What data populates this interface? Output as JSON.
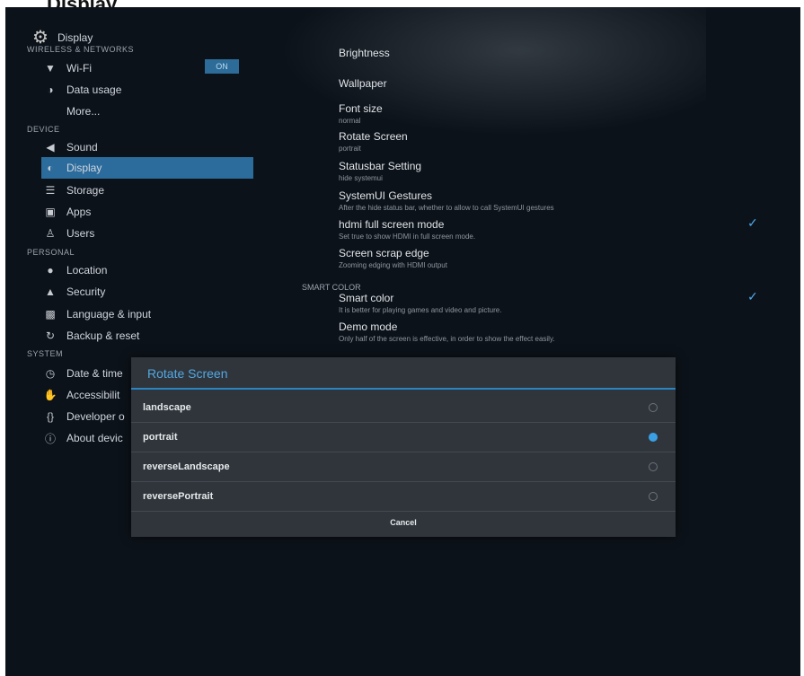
{
  "caption": "Display",
  "header": {
    "title": "Display"
  },
  "sections": {
    "wireless": "WIRELESS & NETWORKS",
    "device": "DEVICE",
    "personal": "PERSONAL",
    "system": "SYSTEM",
    "smart_color": "SMART COLOR"
  },
  "sidebar": {
    "wifi": {
      "label": "Wi-Fi",
      "toggle": "ON"
    },
    "data_usage": "Data usage",
    "more": "More...",
    "sound": "Sound",
    "display": "Display",
    "storage": "Storage",
    "apps": "Apps",
    "users": "Users",
    "location": "Location",
    "security": "Security",
    "language": "Language & input",
    "backup": "Backup & reset",
    "date_time": "Date & time",
    "accessibility": "Accessibilit",
    "developer": "Developer o",
    "about": "About devic"
  },
  "prefs": {
    "brightness": "Brightness",
    "wallpaper": "Wallpaper",
    "font_size": {
      "title": "Font size",
      "summary": "normal"
    },
    "rotate": {
      "title": "Rotate Screen",
      "summary": "portrait"
    },
    "statusbar": {
      "title": "Statusbar Setting",
      "summary": "hide systemui"
    },
    "gestures": {
      "title": "SystemUI Gestures",
      "summary": "After the hide status bar, whether to allow to call SystemUI gestures"
    },
    "hdmi": {
      "title": "hdmi full screen mode",
      "summary": "Set true to show HDMI in full screen mode."
    },
    "scrap": {
      "title": "Screen scrap edge",
      "summary": "Zooming edging with HDMI output"
    },
    "smart": {
      "title": "Smart color",
      "summary": "It is better for playing games and video and picture."
    },
    "demo": {
      "title": "Demo mode",
      "summary": "Only half of the screen is effective, in order to show the effect easily."
    }
  },
  "dialog": {
    "title": "Rotate Screen",
    "options": [
      "landscape",
      "portrait",
      "reverseLandscape",
      "reversePortrait"
    ],
    "selected": "portrait",
    "cancel": "Cancel"
  },
  "colors": {
    "accent": "#3b9fe3",
    "selected_row": "#2c6c9d"
  }
}
